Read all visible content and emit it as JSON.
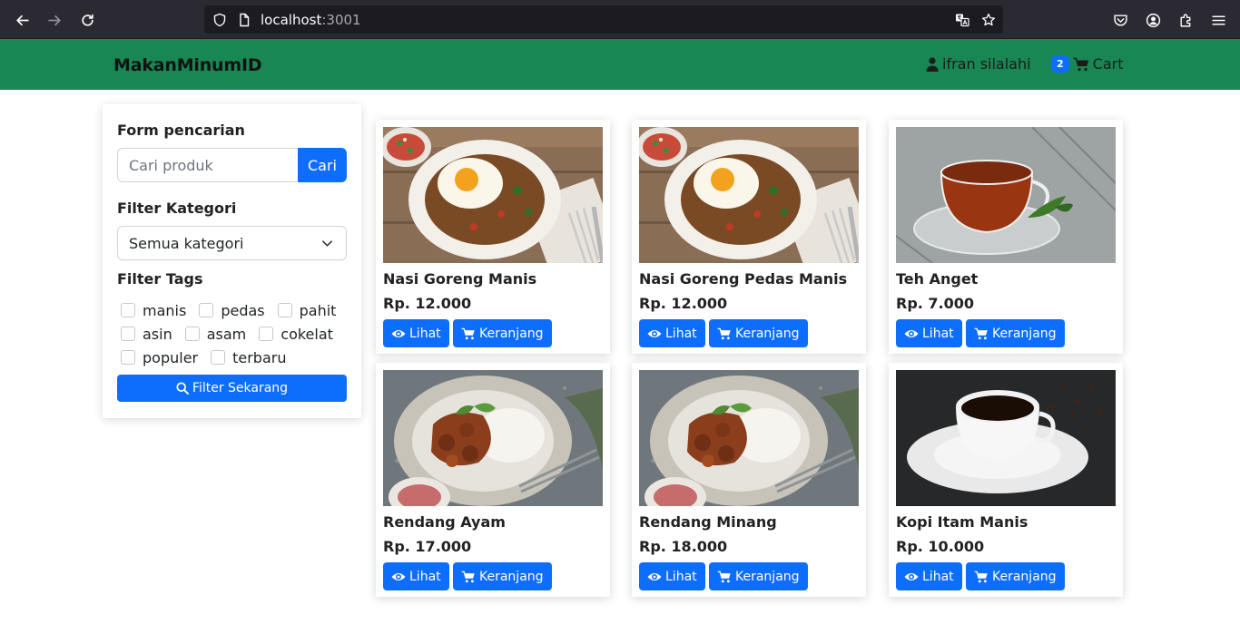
{
  "browser": {
    "url_host": "localhost",
    "url_port": ":3001"
  },
  "navbar": {
    "brand": "MakanMinumID",
    "user_name": "ifran silalahi",
    "cart_count": "2",
    "cart_label": "Cart",
    "color": "#198754"
  },
  "sidebar": {
    "search_title": "Form pencarian",
    "search_placeholder": "Cari produk",
    "search_button": "Cari",
    "category_title": "Filter Kategori",
    "category_selected": "Semua kategori",
    "tags_title": "Filter Tags",
    "tags": [
      "manis",
      "pedas",
      "pahit",
      "asin",
      "asam",
      "cokelat",
      "populer",
      "terbaru"
    ],
    "filter_button": "Filter Sekarang"
  },
  "products": [
    {
      "name": "Nasi Goreng Manis",
      "price": "Rp. 12.000",
      "view_label": "Lihat",
      "cart_label": "Keranjang",
      "image": "fried-rice"
    },
    {
      "name": "Nasi Goreng Pedas Manis",
      "price": "Rp. 12.000",
      "view_label": "Lihat",
      "cart_label": "Keranjang",
      "image": "fried-rice"
    },
    {
      "name": "Teh Anget",
      "price": "Rp. 7.000",
      "view_label": "Lihat",
      "cart_label": "Keranjang",
      "image": "tea"
    },
    {
      "name": "Rendang Ayam",
      "price": "Rp. 17.000",
      "view_label": "Lihat",
      "cart_label": "Keranjang",
      "image": "rendang"
    },
    {
      "name": "Rendang Minang",
      "price": "Rp. 18.000",
      "view_label": "Lihat",
      "cart_label": "Keranjang",
      "image": "rendang"
    },
    {
      "name": "Kopi Itam Manis",
      "price": "Rp. 10.000",
      "view_label": "Lihat",
      "cart_label": "Keranjang",
      "image": "coffee"
    }
  ],
  "colors": {
    "primary": "#0d6efd",
    "success": "#198754"
  }
}
